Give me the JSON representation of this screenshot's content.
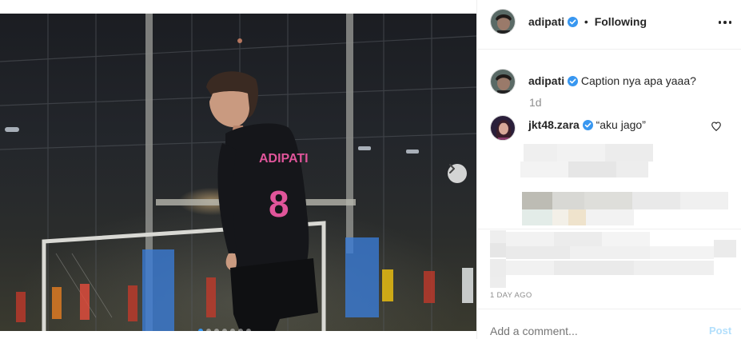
{
  "post": {
    "author": "adipati",
    "follow_status": "Following",
    "separator": "•",
    "jersey_text": "ADIPATI",
    "jersey_number": "8",
    "carousel_total": 7,
    "carousel_active_index": 0
  },
  "comments": [
    {
      "username": "adipati",
      "text": "Caption nya apa yaaa?",
      "time": "1d"
    },
    {
      "username": "jkt48.zara",
      "text": "“aku jago”"
    }
  ],
  "footer": {
    "posted_ago": "1 DAY AGO",
    "add_comment_placeholder": "Add a comment...",
    "post_label": "Post"
  },
  "colors": {
    "verified_blue": "#3897f0",
    "post_button_disabled": "#b2dffc",
    "jersey_pink": "#e0559a"
  },
  "icons": {
    "verified": "verified-badge-icon",
    "more": "more-options-icon",
    "heart": "heart-outline-icon",
    "next": "chevron-right-icon"
  }
}
